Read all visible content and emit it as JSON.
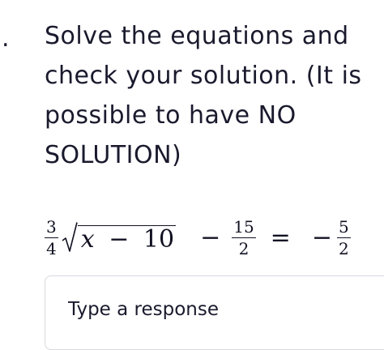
{
  "question": {
    "number_marker": ".",
    "prompt": "Solve the equations and check your solution. (It is possible to have NO SOLUTION)"
  },
  "equation": {
    "coefficient": {
      "numerator": "3",
      "denominator": "4"
    },
    "radicand_variable": "x",
    "radicand_operator": "−",
    "radicand_constant": "10",
    "minus": "−",
    "term": {
      "numerator": "15",
      "denominator": "2"
    },
    "equals": "=",
    "rhs_sign": "−",
    "rhs": {
      "numerator": "5",
      "denominator": "2"
    }
  },
  "response": {
    "placeholder": "Type a response",
    "value": ""
  }
}
